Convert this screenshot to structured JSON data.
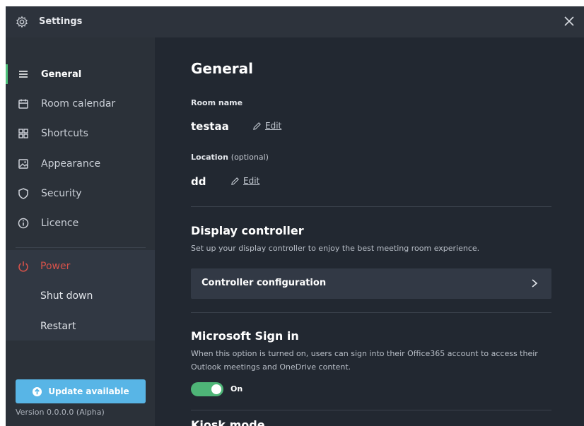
{
  "window": {
    "title": "Settings"
  },
  "sidebar": {
    "items": [
      {
        "label": "General",
        "icon": "list-icon"
      },
      {
        "label": "Room calendar",
        "icon": "calendar-icon"
      },
      {
        "label": "Shortcuts",
        "icon": "grid-icon"
      },
      {
        "label": "Appearance",
        "icon": "image-icon"
      },
      {
        "label": "Security",
        "icon": "shield-icon"
      },
      {
        "label": "Licence",
        "icon": "info-icon"
      }
    ],
    "power": {
      "label": "Power",
      "shutdown": "Shut down",
      "restart": "Restart"
    },
    "update_label": "Update available",
    "version": "Version 0.0.0.0 (Alpha)"
  },
  "main": {
    "title": "General",
    "room_name": {
      "label": "Room name",
      "value": "testaa",
      "edit": "Edit"
    },
    "location": {
      "label": "Location",
      "optional": "(optional)",
      "value": "dd",
      "edit": "Edit"
    },
    "display_controller": {
      "title": "Display controller",
      "description": "Set up your display controller to enjoy the best meeting room experience.",
      "button": "Controller configuration"
    },
    "microsoft_signin": {
      "title": "Microsoft Sign in",
      "description": "When this option is turned on, users can sign into their Office365 account to access their Outlook meetings and OneDrive content.",
      "toggle_label": "On",
      "toggle_on": true
    },
    "next_section_title": "Kiosk mode"
  },
  "colors": {
    "accent_green": "#4eb577",
    "update_blue": "#58b5e6",
    "power_red": "#d6524a",
    "background": "#222831"
  }
}
